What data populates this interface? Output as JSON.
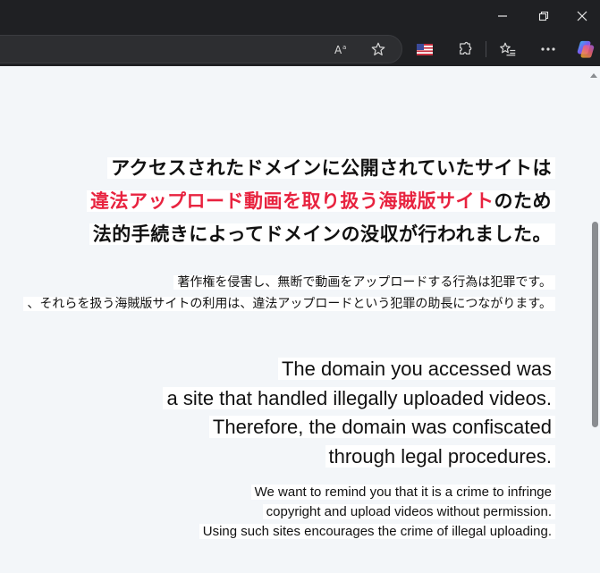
{
  "browser": {
    "window_controls": {
      "minimize": "minimize-icon",
      "restore": "restore-icon",
      "close": "close-icon"
    },
    "toolbar_icons": [
      "read-aloud-icon",
      "favorite-star-icon",
      "us-flag-icon",
      "extensions-icon",
      "favorites-icon",
      "more-icon",
      "copilot-icon"
    ]
  },
  "page": {
    "jp_heading": {
      "line1": "アクセスされたドメインに公開されていたサイトは",
      "line2_highlight": "違法アップロード動画を取り扱う海賊版サイト",
      "line2_rest": "のため",
      "line3": "法的手続きによってドメインの没収が行われました。"
    },
    "jp_sub": {
      "line1": "著作権を侵害し、無断で動画をアップロードする行為は犯罪です。",
      "line2": "、それらを扱う海賊版サイトの利用は、違法アップロードという犯罪の助長につながります。"
    },
    "en_heading": {
      "line1": "The domain you accessed was",
      "line2": "a site that handled illegally uploaded videos.",
      "line3": "Therefore, the domain was confiscated",
      "line4": "through legal procedures."
    },
    "en_sub": {
      "line1": "We want to remind you that it is a crime to infringe",
      "line2": "copyright and upload videos without permission.",
      "line3": "Using such sites encourages the crime of illegal uploading."
    }
  },
  "colors": {
    "accent_red": "#e8233f",
    "chrome_dark": "#1f2023",
    "page_bg": "#f3f6f9"
  }
}
